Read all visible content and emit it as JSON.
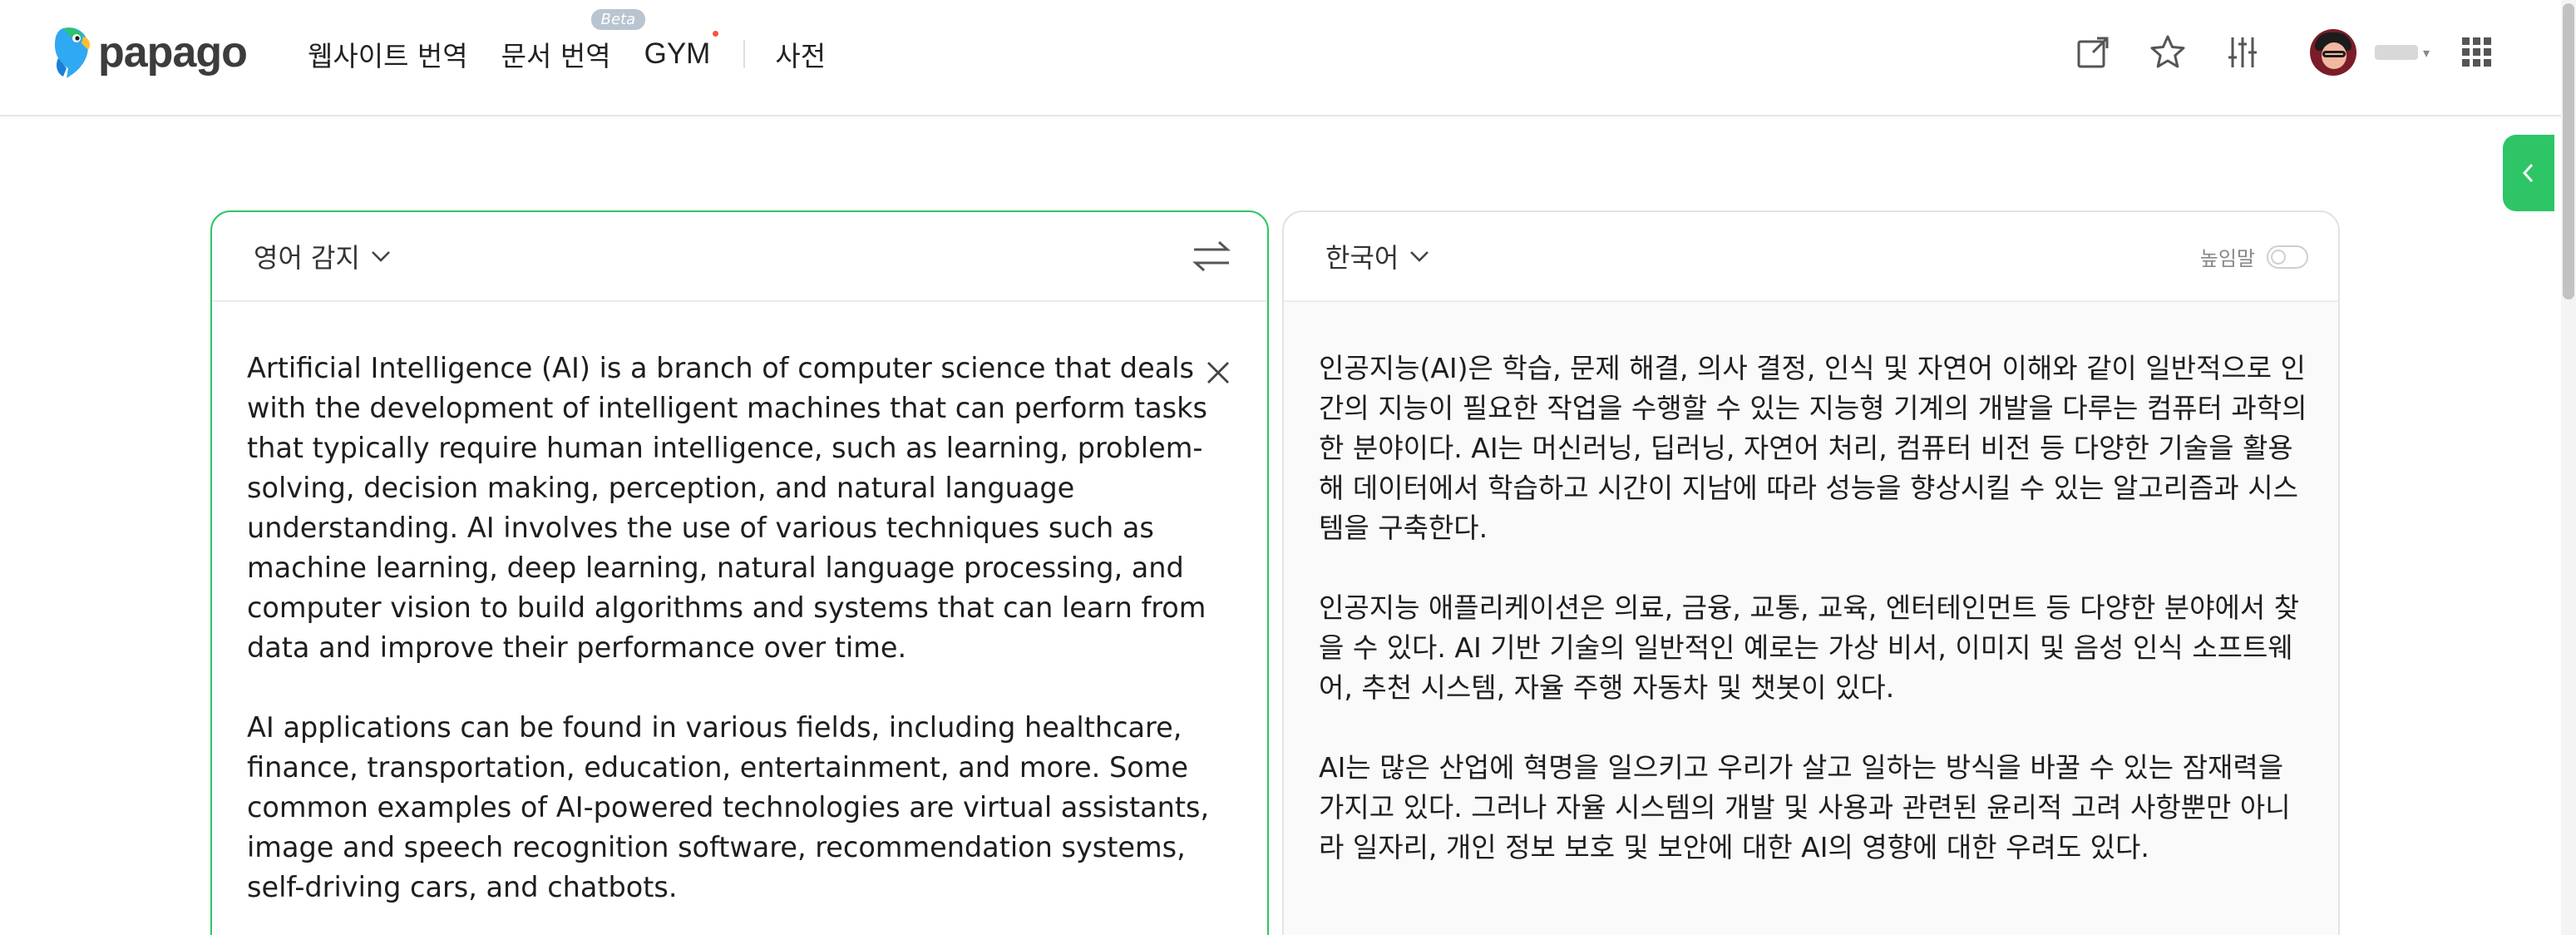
{
  "header": {
    "logo_text": "papago",
    "nav": [
      {
        "label": "웹사이트 번역"
      },
      {
        "label": "문서 번역",
        "badge": "Beta"
      },
      {
        "label": "GYM"
      },
      {
        "label": "사전"
      }
    ],
    "icons": [
      "share-icon",
      "star-icon",
      "settings-sliders-icon",
      "apps-grid-icon"
    ],
    "accent_color": "#2dc566"
  },
  "source": {
    "language": "영어 감지",
    "paragraphs": [
      "Artificial Intelligence (AI) is a branch of computer science that deals with the development of intelligent machines that can perform tasks that typically require human intelligence, such as learning, problem-solving, decision making, perception, and natural language understanding. AI involves the use of various techniques such as machine learning, deep learning, natural language processing, and computer vision to build algorithms and systems that can learn from data and improve their performance over time.",
      "AI applications can be found in various fields, including healthcare, finance, transportation, education, entertainment, and more. Some common examples of AI-powered technologies are virtual assistants, image and speech recognition software, recommendation systems, self-driving cars, and chatbots."
    ]
  },
  "target": {
    "language": "한국어",
    "honorific_label": "높임말",
    "paragraphs": [
      "인공지능(AI)은 학습, 문제 해결, 의사 결정, 인식 및 자연어 이해와 같이 일반적으로 인간의 지능이 필요한 작업을 수행할 수 있는 지능형 기계의 개발을 다루는 컴퓨터 과학의 한 분야이다. AI는 머신러닝, 딥러닝, 자연어 처리, 컴퓨터 비전 등 다양한 기술을 활용해 데이터에서 학습하고 시간이 지남에 따라 성능을 향상시킬 수 있는 알고리즘과 시스템을 구축한다.",
      "인공지능 애플리케이션은 의료, 금융, 교통, 교육, 엔터테인먼트 등 다양한 분야에서 찾을 수 있다. AI 기반 기술의 일반적인 예로는 가상 비서, 이미지 및 음성 인식 소프트웨어, 추천 시스템, 자율 주행 자동차 및 챗봇이 있다.",
      "AI는 많은 산업에 혁명을 일으키고 우리가 살고 일하는 방식을 바꿀 수 있는 잠재력을 가지고 있다. 그러나 자율 시스템의 개발 및 사용과 관련된 윤리적 고려 사항뿐만 아니라 일자리, 개인 정보 보호 및 보안에 대한 AI의 영향에 대한 우려도 있다."
    ]
  }
}
